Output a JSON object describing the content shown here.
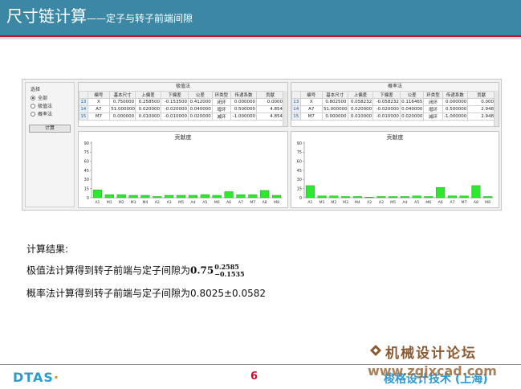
{
  "header": {
    "title": "尺寸链计算",
    "subtitle": "——定子与转子前端间隙"
  },
  "software": {
    "selection": {
      "title": "选择",
      "options": [
        "全部",
        "极值法",
        "概率法"
      ],
      "selected": "全部",
      "button": "计算"
    },
    "tables": [
      {
        "caption": "极值法",
        "headers": [
          "编号",
          "基本尺寸",
          "上偏差",
          "下偏差",
          "公差",
          "环类型",
          "传递系数",
          "贡献"
        ],
        "rows": [
          [
            "13",
            "X",
            "0.750000",
            "0.258500",
            "-0.153500",
            "0.412000",
            "闭环",
            "0.000000",
            "0.0000"
          ],
          [
            "14",
            "A7",
            "51.000000",
            "0.020000",
            "-0.020000",
            "0.040000",
            "增环",
            "0.500000",
            "4.854"
          ],
          [
            "15",
            "M7",
            "0.000000",
            "0.010000",
            "-0.010000",
            "0.020000",
            "减环",
            "-1.000000",
            "4.854"
          ]
        ]
      },
      {
        "caption": "概率法",
        "headers": [
          "编号",
          "基本尺寸",
          "上偏差",
          "下偏差",
          "公差",
          "环类型",
          "传递系数",
          "贡献"
        ],
        "rows": [
          [
            "13",
            "X",
            "0.802500",
            "0.058232",
            "-0.058232",
            "0.116465",
            "闭环",
            "0.000000",
            "0.000"
          ],
          [
            "14",
            "A7",
            "51.000000",
            "0.020000",
            "-0.020000",
            "0.040000",
            "增环",
            "0.500000",
            "2.948"
          ],
          [
            "15",
            "M7",
            "0.000000",
            "0.010000",
            "-0.010000",
            "0.020000",
            "减环",
            "-1.000000",
            "2.948"
          ]
        ]
      }
    ]
  },
  "chart_data": [
    {
      "type": "bar",
      "title": "贡献度",
      "categories": [
        "A1",
        "M1",
        "M2",
        "M3",
        "M4",
        "A2",
        "A3",
        "M5",
        "A4",
        "A5",
        "M6",
        "A6",
        "A7",
        "M7",
        "A8",
        "M8"
      ],
      "values": [
        13,
        5,
        5,
        4,
        4,
        2,
        4,
        4,
        4,
        5,
        4,
        10,
        5,
        5,
        12,
        4
      ],
      "y_ticks": [
        0,
        15,
        30,
        45,
        60,
        75,
        90
      ],
      "ylim": [
        0,
        90
      ],
      "color": "#2ee82e"
    },
    {
      "type": "bar",
      "title": "贡献度",
      "categories": [
        "A1",
        "M1",
        "M2",
        "M3",
        "M4",
        "A2",
        "A3",
        "M5",
        "A4",
        "A5",
        "M6",
        "A6",
        "A7",
        "M7",
        "A8",
        "M8"
      ],
      "values": [
        20,
        3,
        3,
        2,
        2,
        1,
        2,
        2,
        2,
        3,
        2,
        17,
        3,
        3,
        20,
        2
      ],
      "y_ticks": [
        0,
        15,
        30,
        45,
        60,
        75,
        90
      ],
      "ylim": [
        0,
        90
      ],
      "color": "#2ee82e"
    }
  ],
  "results": {
    "heading": "计算结果:",
    "line1_text": "极值法计算得到转子前端与定子间隙为",
    "line1_value": "0.75",
    "line1_upper": "0.2585",
    "line1_lower": "−0.1535",
    "line2": "概率法计算得到转子前端与定子间隙为0.8025±0.0582"
  },
  "footer": {
    "logo_main": "DTAS",
    "page_number": "6",
    "right_text": "梭格设计技术 (上海)",
    "watermark_cn": "机械设计论坛",
    "watermark_url": "www.zgjxcad.com"
  }
}
